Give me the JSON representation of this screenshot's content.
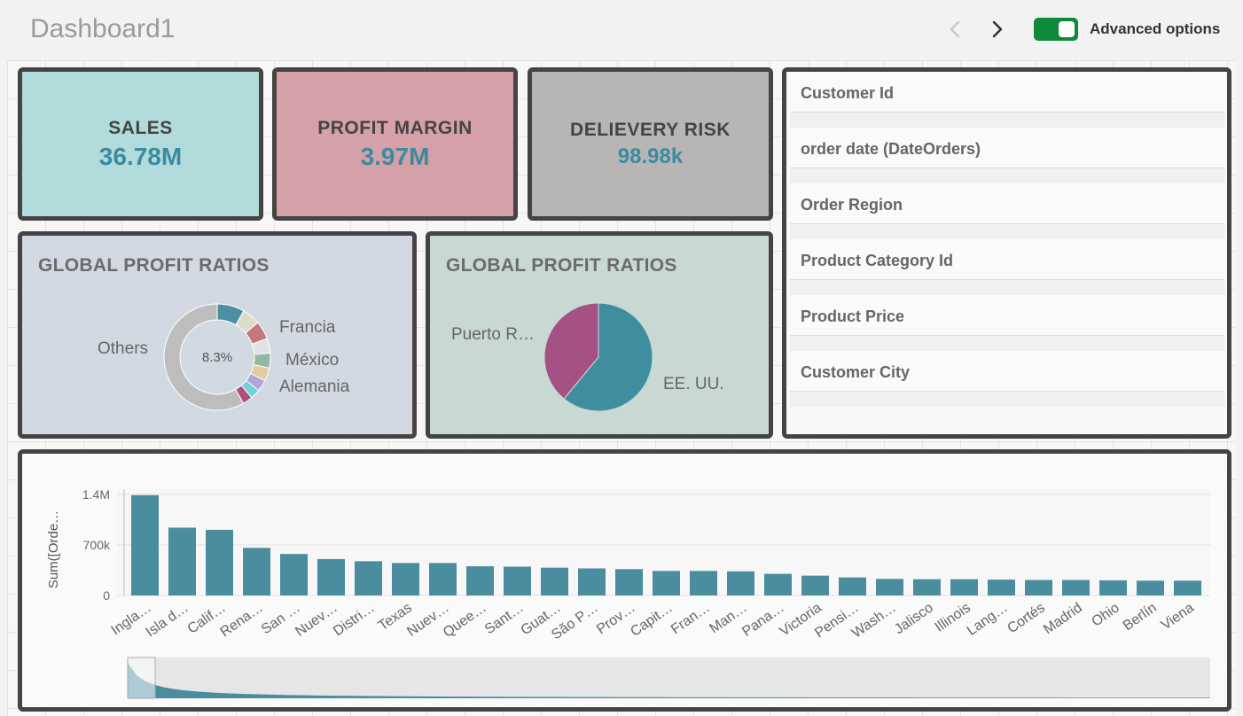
{
  "header": {
    "title": "Dashboard1",
    "toggle_label": "Advanced options",
    "toggle_on": true,
    "toggle_color": "#0f8a3a"
  },
  "kpis": {
    "sales": {
      "title": "SALES",
      "value": "36.78M",
      "color": "#b2dcdb"
    },
    "profit": {
      "title": "PROFIT MARGIN",
      "value": "3.97M",
      "color": "#d5a0a8"
    },
    "risk": {
      "title": "DELIEVERY RISK",
      "value": "98.98k",
      "color": "#b8b6b4"
    }
  },
  "filters": [
    "Customer Id",
    "order date (DateOrders)",
    "Order Region",
    "Product Category Id",
    "Product Price",
    "Customer City"
  ],
  "chart_data": [
    {
      "type": "pie",
      "variant": "donut",
      "title": "GLOBAL PROFIT RATIOS",
      "center_label": "8.3%",
      "labels": [
        "Others",
        "Francia",
        "México",
        "Alemania"
      ],
      "slices": [
        {
          "name": "Francia",
          "value": 8.3,
          "color": "#4c8fa0"
        },
        {
          "name": "",
          "value": 5.5,
          "color": "#dcdccd"
        },
        {
          "name": "México",
          "value": 5.5,
          "color": "#c2787c"
        },
        {
          "name": "",
          "value": 4.5,
          "color": "#e2e2e2"
        },
        {
          "name": "Alemania",
          "value": 4.5,
          "color": "#97b7a5"
        },
        {
          "name": "",
          "value": 4,
          "color": "#e4cba0"
        },
        {
          "name": "",
          "value": 3.5,
          "color": "#aea6d6"
        },
        {
          "name": "",
          "value": 3,
          "color": "#6fd3d9"
        },
        {
          "name": "",
          "value": 3,
          "color": "#ae4f7e"
        },
        {
          "name": "Others",
          "value": 58.2,
          "color": "#bdbdbd"
        }
      ],
      "legend": "none"
    },
    {
      "type": "pie",
      "title": "GLOBAL PROFIT RATIOS",
      "labels": [
        "Puerto R…",
        "EE. UU."
      ],
      "slices": [
        {
          "name": "EE. UU.",
          "value": 61,
          "color": "#3f8ea0"
        },
        {
          "name": "Puerto R…",
          "value": 39,
          "color": "#a65184"
        }
      ],
      "legend": "none"
    },
    {
      "type": "bar",
      "ylabel": "Sum([Orde…",
      "yticks": [
        "0",
        "700k",
        "1.4M"
      ],
      "ylim": [
        0,
        1400000
      ],
      "color": "#4a8d9f",
      "categories": [
        "Ingla…",
        "Isla d…",
        "Calif…",
        "Rena…",
        "San …",
        "Nuev…",
        "Distri…",
        "Texas",
        "Nuev…",
        "Quee…",
        "Sant…",
        "Guat…",
        "São P…",
        "Prov…",
        "Capit…",
        "Fran…",
        "Man…",
        "Pana…",
        "Victoria",
        "Pensi…",
        "Wash…",
        "Jalisco",
        "Illinois",
        "Lang…",
        "Cortés",
        "Madrid",
        "Ohio",
        "Berlín",
        "Viena"
      ],
      "values": [
        1390000,
        940000,
        910000,
        660000,
        575000,
        505000,
        475000,
        450000,
        450000,
        405000,
        400000,
        385000,
        375000,
        365000,
        340000,
        340000,
        335000,
        300000,
        275000,
        250000,
        230000,
        225000,
        225000,
        220000,
        215000,
        215000,
        210000,
        205000,
        205000
      ],
      "grid": true,
      "has_scrollbar": true
    }
  ]
}
